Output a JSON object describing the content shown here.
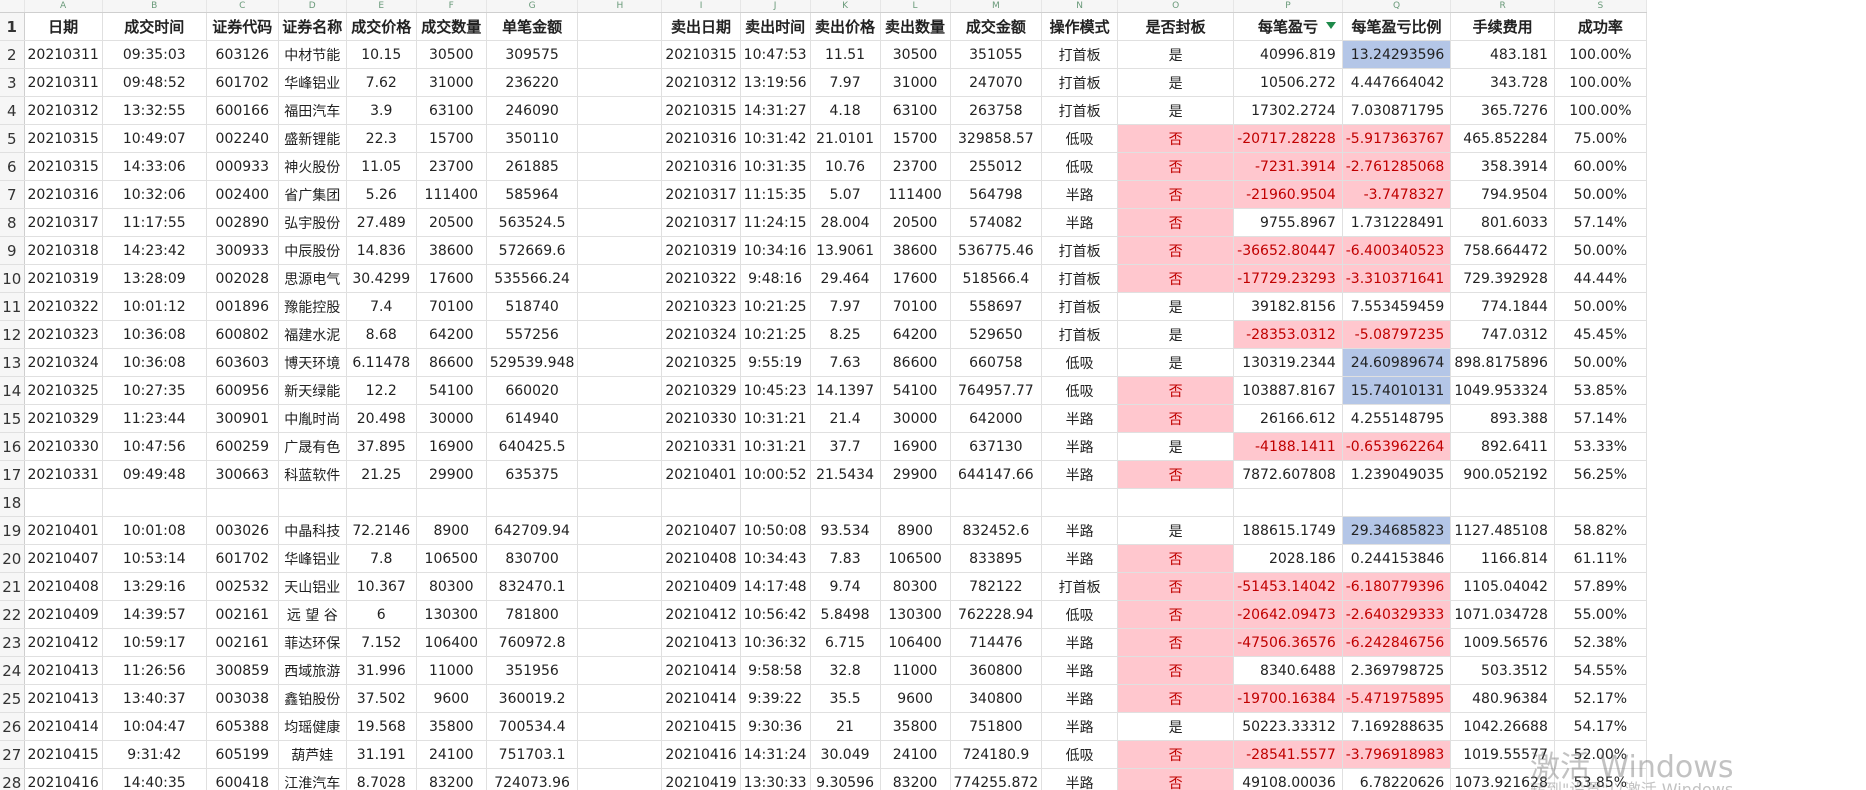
{
  "column_letters": [
    "A",
    "B",
    "C",
    "D",
    "E",
    "F",
    "G",
    "H",
    "I",
    "J",
    "K",
    "L",
    "M",
    "N",
    "O",
    "P",
    "Q",
    "R",
    "S"
  ],
  "headers": [
    "日期",
    "成交时间",
    "证券代码",
    "证券名称",
    "成交价格",
    "成交数量",
    "单笔金额",
    "",
    "卖出日期",
    "卖出时间",
    "卖出价格",
    "卖出数量",
    "成交金额",
    "操作模式",
    "是否封板",
    "每笔盈亏",
    "每笔盈亏比例",
    "手续费用",
    "成功率"
  ],
  "rows": [
    {
      "n": "2",
      "c": [
        "20210311",
        "09:35:03",
        "603126",
        "中材节能",
        "10.15",
        "30500",
        "309575",
        "",
        "20210315",
        "10:47:53",
        "11.51",
        "30500",
        "351055",
        "打首板",
        "是",
        "40996.819",
        "13.24293596",
        "483.181",
        "100.00%"
      ],
      "red": false,
      "blue": true
    },
    {
      "n": "3",
      "c": [
        "20210311",
        "09:48:52",
        "601702",
        "华峰铝业",
        "7.62",
        "31000",
        "236220",
        "",
        "20210312",
        "13:19:56",
        "7.97",
        "31000",
        "247070",
        "打首板",
        "是",
        "10506.272",
        "4.447664042",
        "343.728",
        "100.00%"
      ],
      "red": false,
      "blue": false
    },
    {
      "n": "4",
      "c": [
        "20210312",
        "13:32:55",
        "600166",
        "福田汽车",
        "3.9",
        "63100",
        "246090",
        "",
        "20210315",
        "14:31:27",
        "4.18",
        "63100",
        "263758",
        "打首板",
        "是",
        "17302.2724",
        "7.030871795",
        "365.7276",
        "100.00%"
      ],
      "red": false,
      "blue": false
    },
    {
      "n": "5",
      "c": [
        "20210315",
        "10:49:07",
        "002240",
        "盛新锂能",
        "22.3",
        "15700",
        "350110",
        "",
        "20210316",
        "10:31:42",
        "21.0101",
        "15700",
        "329858.57",
        "低吸",
        "否",
        "-20717.28228",
        "-5.917363767",
        "465.852284",
        "75.00%"
      ],
      "red": true,
      "blue": false
    },
    {
      "n": "6",
      "c": [
        "20210315",
        "14:33:06",
        "000933",
        "神火股份",
        "11.05",
        "23700",
        "261885",
        "",
        "20210316",
        "10:31:35",
        "10.76",
        "23700",
        "255012",
        "低吸",
        "否",
        "-7231.3914",
        "-2.761285068",
        "358.3914",
        "60.00%"
      ],
      "red": true,
      "blue": false
    },
    {
      "n": "7",
      "c": [
        "20210316",
        "10:32:06",
        "002400",
        "省广集团",
        "5.26",
        "111400",
        "585964",
        "",
        "20210317",
        "11:15:35",
        "5.07",
        "111400",
        "564798",
        "半路",
        "否",
        "-21960.9504",
        "-3.7478327",
        "794.9504",
        "50.00%"
      ],
      "red": true,
      "blue": false
    },
    {
      "n": "8",
      "c": [
        "20210317",
        "11:17:55",
        "002890",
        "弘宇股份",
        "27.489",
        "20500",
        "563524.5",
        "",
        "20210317",
        "11:24:15",
        "28.004",
        "20500",
        "574082",
        "半路",
        "否",
        "9755.8967",
        "1.731228491",
        "801.6033",
        "57.14%"
      ],
      "red": "partial",
      "blue": false
    },
    {
      "n": "9",
      "c": [
        "20210318",
        "14:23:42",
        "300933",
        "中辰股份",
        "14.836",
        "38600",
        "572669.6",
        "",
        "20210319",
        "10:34:16",
        "13.9061",
        "38600",
        "536775.46",
        "打首板",
        "否",
        "-36652.80447",
        "-6.400340523",
        "758.664472",
        "50.00%"
      ],
      "red": true,
      "blue": false
    },
    {
      "n": "10",
      "c": [
        "20210319",
        "13:28:09",
        "002028",
        "思源电气",
        "30.4299",
        "17600",
        "535566.24",
        "",
        "20210322",
        "9:48:16",
        "29.464",
        "17600",
        "518566.4",
        "打首板",
        "否",
        "-17729.23293",
        "-3.310371641",
        "729.392928",
        "44.44%"
      ],
      "red": true,
      "blue": false
    },
    {
      "n": "11",
      "c": [
        "20210322",
        "10:01:12",
        "001896",
        "豫能控股",
        "7.4",
        "70100",
        "518740",
        "",
        "20210323",
        "10:21:25",
        "7.97",
        "70100",
        "558697",
        "打首板",
        "是",
        "39182.8156",
        "7.553459459",
        "774.1844",
        "50.00%"
      ],
      "red": false,
      "blue": false
    },
    {
      "n": "12",
      "c": [
        "20210323",
        "10:36:08",
        "600802",
        "福建水泥",
        "8.68",
        "64200",
        "557256",
        "",
        "20210324",
        "10:21:25",
        "8.25",
        "64200",
        "529650",
        "打首板",
        "是",
        "-28353.0312",
        "-5.08797235",
        "747.0312",
        "45.45%"
      ],
      "red": "vals",
      "blue": false
    },
    {
      "n": "13",
      "c": [
        "20210324",
        "10:36:08",
        "603603",
        "博天环境",
        "6.11478",
        "86600",
        "529539.948",
        "",
        "20210325",
        "9:55:19",
        "7.63",
        "86600",
        "660758",
        "低吸",
        "是",
        "130319.2344",
        "24.60989674",
        "898.8175896",
        "50.00%"
      ],
      "red": false,
      "blue": true
    },
    {
      "n": "14",
      "c": [
        "20210325",
        "10:27:35",
        "600956",
        "新天绿能",
        "12.2",
        "54100",
        "660020",
        "",
        "20210329",
        "10:45:23",
        "14.1397",
        "54100",
        "764957.77",
        "低吸",
        "否",
        "103887.8167",
        "15.74010131",
        "1049.953324",
        "53.85%"
      ],
      "red": "flag",
      "blue": true
    },
    {
      "n": "15",
      "c": [
        "20210329",
        "11:23:44",
        "300901",
        "中胤时尚",
        "20.498",
        "30000",
        "614940",
        "",
        "20210330",
        "10:31:21",
        "21.4",
        "30000",
        "642000",
        "半路",
        "否",
        "26166.612",
        "4.255148795",
        "893.388",
        "57.14%"
      ],
      "red": "flag",
      "blue": false
    },
    {
      "n": "16",
      "c": [
        "20210330",
        "10:47:56",
        "600259",
        "广晟有色",
        "37.895",
        "16900",
        "640425.5",
        "",
        "20210331",
        "10:31:21",
        "37.7",
        "16900",
        "637130",
        "半路",
        "是",
        "-4188.1411",
        "-0.653962264",
        "892.6411",
        "53.33%"
      ],
      "red": "vals",
      "blue": false
    },
    {
      "n": "17",
      "c": [
        "20210331",
        "09:49:48",
        "300663",
        "科蓝软件",
        "21.25",
        "29900",
        "635375",
        "",
        "20210401",
        "10:00:52",
        "21.5434",
        "29900",
        "644147.66",
        "半路",
        "否",
        "7872.607808",
        "1.239049035",
        "900.052192",
        "56.25%"
      ],
      "red": "flag",
      "blue": false
    },
    {
      "n": "18",
      "c": [
        "",
        "",
        "",
        "",
        "",
        "",
        "",
        "",
        "",
        "",
        "",
        "",
        "",
        "",
        "",
        "",
        "",
        "",
        ""
      ],
      "red": false,
      "blue": false
    },
    {
      "n": "19",
      "c": [
        "20210401",
        "10:01:08",
        "003026",
        "中晶科技",
        "72.2146",
        "8900",
        "642709.94",
        "",
        "20210407",
        "10:50:08",
        "93.534",
        "8900",
        "832452.6",
        "半路",
        "是",
        "188615.1749",
        "29.34685823",
        "1127.485108",
        "58.82%"
      ],
      "red": false,
      "blue": true
    },
    {
      "n": "20",
      "c": [
        "20210407",
        "10:53:14",
        "601702",
        "华峰铝业",
        "7.8",
        "106500",
        "830700",
        "",
        "20210408",
        "10:34:43",
        "7.83",
        "106500",
        "833895",
        "半路",
        "否",
        "2028.186",
        "0.244153846",
        "1166.814",
        "61.11%"
      ],
      "red": "flag",
      "blue": false
    },
    {
      "n": "21",
      "c": [
        "20210408",
        "13:29:16",
        "002532",
        "天山铝业",
        "10.367",
        "80300",
        "832470.1",
        "",
        "20210409",
        "14:17:48",
        "9.74",
        "80300",
        "782122",
        "打首板",
        "否",
        "-51453.14042",
        "-6.180779396",
        "1105.04042",
        "57.89%"
      ],
      "red": true,
      "blue": false
    },
    {
      "n": "22",
      "c": [
        "20210409",
        "14:39:57",
        "002161",
        "远 望 谷",
        "6",
        "130300",
        "781800",
        "",
        "20210412",
        "10:56:42",
        "5.8498",
        "130300",
        "762228.94",
        "低吸",
        "否",
        "-20642.09473",
        "-2.640329333",
        "1071.034728",
        "55.00%"
      ],
      "red": true,
      "blue": false
    },
    {
      "n": "23",
      "c": [
        "20210412",
        "10:59:17",
        "002161",
        "菲达环保",
        "7.152",
        "106400",
        "760972.8",
        "",
        "20210413",
        "10:36:32",
        "6.715",
        "106400",
        "714476",
        "半路",
        "否",
        "-47506.36576",
        "-6.242846756",
        "1009.56576",
        "52.38%"
      ],
      "red": true,
      "blue": false
    },
    {
      "n": "24",
      "c": [
        "20210413",
        "11:26:56",
        "300859",
        "西域旅游",
        "31.996",
        "11000",
        "351956",
        "",
        "20210414",
        "9:58:58",
        "32.8",
        "11000",
        "360800",
        "半路",
        "否",
        "8340.6488",
        "2.369798725",
        "503.3512",
        "54.55%"
      ],
      "red": "flag",
      "blue": false
    },
    {
      "n": "25",
      "c": [
        "20210413",
        "13:40:37",
        "003038",
        "鑫铂股份",
        "37.502",
        "9600",
        "360019.2",
        "",
        "20210414",
        "9:39:22",
        "35.5",
        "9600",
        "340800",
        "半路",
        "否",
        "-19700.16384",
        "-5.471975895",
        "480.96384",
        "52.17%"
      ],
      "red": true,
      "blue": false
    },
    {
      "n": "26",
      "c": [
        "20210414",
        "10:04:47",
        "605388",
        "均瑶健康",
        "19.568",
        "35800",
        "700534.4",
        "",
        "20210415",
        "9:30:36",
        "21",
        "35800",
        "751800",
        "半路",
        "是",
        "50223.33312",
        "7.169288635",
        "1042.26688",
        "54.17%"
      ],
      "red": false,
      "blue": false
    },
    {
      "n": "27",
      "c": [
        "20210415",
        "9:31:42",
        "605199",
        "葫芦娃",
        "31.191",
        "24100",
        "751703.1",
        "",
        "20210416",
        "14:31:24",
        "30.049",
        "24100",
        "724180.9",
        "低吸",
        "否",
        "-28541.5577",
        "-3.796918983",
        "1019.55577",
        "52.00%"
      ],
      "red": true,
      "blue": false
    },
    {
      "n": "28",
      "c": [
        "20210416",
        "14:40:35",
        "600418",
        "江淮汽车",
        "8.7028",
        "83200",
        "724073.96",
        "",
        "20210419",
        "13:30:33",
        "9.30596",
        "83200",
        "774255.872",
        "半路",
        "否",
        "49108.00036",
        "6.78220626",
        "1073.921628",
        "53.85%"
      ],
      "red": "flag",
      "blue": false
    }
  ],
  "watermark": {
    "line1": "激活 Windows",
    "line2": "转到\"设置\"以激活 Windows。"
  },
  "colors": {
    "red_fill": "#ffc7ce",
    "red_text": "#c00000",
    "blue_fill": "#b4c6e7",
    "grid": "#e0e0e0",
    "accent": "#1e8a4a"
  }
}
